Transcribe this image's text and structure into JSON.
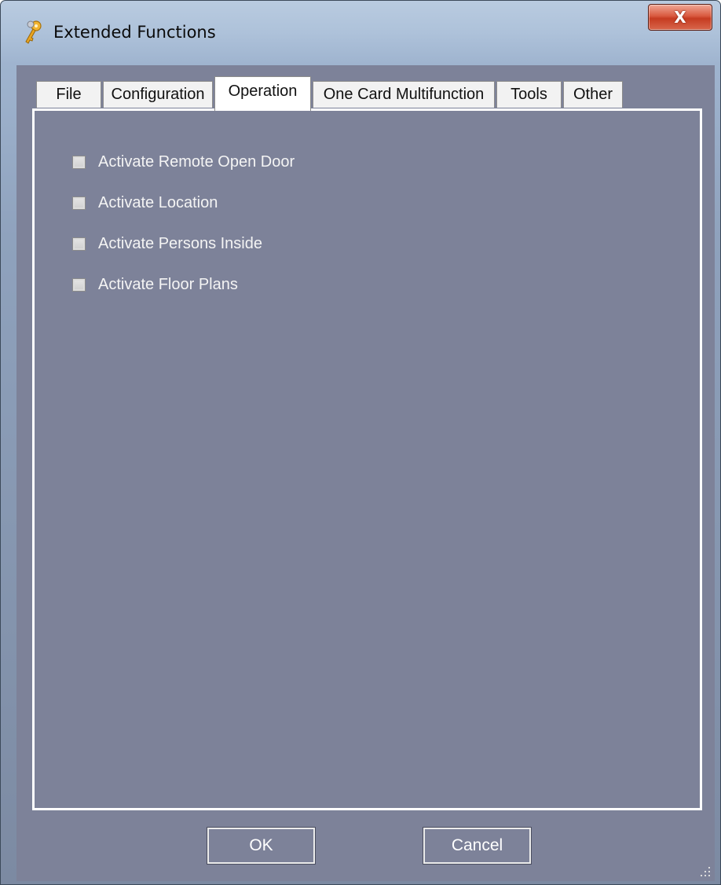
{
  "window": {
    "title": "Extended Functions",
    "close_glyph": "X",
    "app_icon": "keys-icon"
  },
  "tabs": [
    {
      "label": "File",
      "active": false
    },
    {
      "label": "Configuration",
      "active": false
    },
    {
      "label": "Operation",
      "active": true
    },
    {
      "label": "One Card Multifunction",
      "active": false
    },
    {
      "label": "Tools",
      "active": false
    },
    {
      "label": "Other",
      "active": false
    }
  ],
  "operation": {
    "options": [
      {
        "label": "Activate Remote Open Door",
        "checked": false
      },
      {
        "label": "Activate Location",
        "checked": false
      },
      {
        "label": "Activate Persons Inside",
        "checked": false
      },
      {
        "label": "Activate Floor Plans",
        "checked": false
      }
    ]
  },
  "buttons": {
    "ok_label": "OK",
    "cancel_label": "Cancel"
  },
  "colors": {
    "panel_background": "#7d8299",
    "close_button": "#c63b21",
    "title_bar": "#aec2da"
  }
}
